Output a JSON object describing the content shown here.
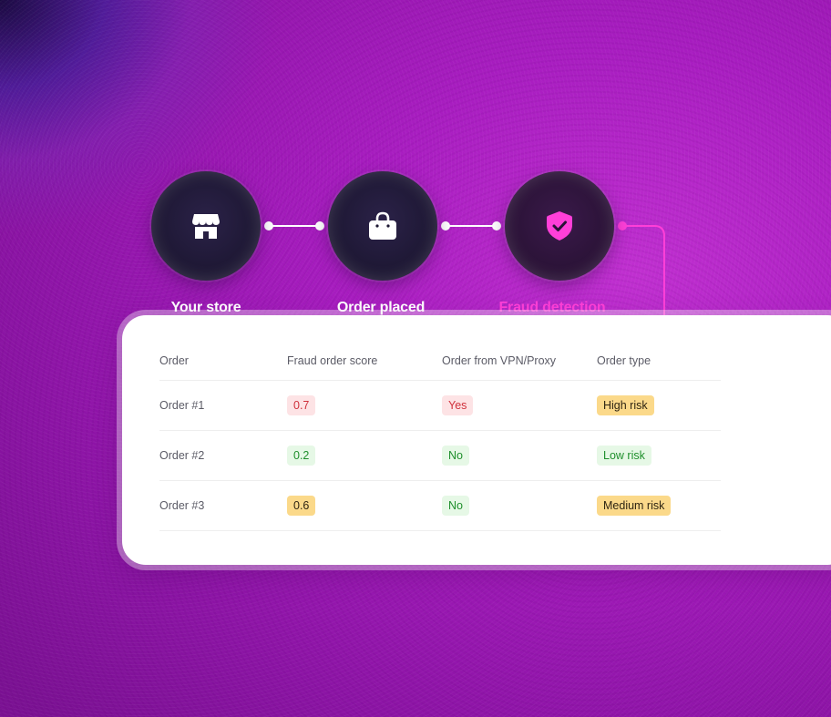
{
  "steps": [
    {
      "label": "Your store",
      "icon": "store-icon"
    },
    {
      "label": "Order placed",
      "icon": "shopping-bag-icon"
    },
    {
      "label": "Fraud detection",
      "icon": "shield-check-icon"
    }
  ],
  "table": {
    "headers": [
      "Order",
      "Fraud order score",
      "Order from VPN/Proxy",
      "Order type"
    ],
    "rows": [
      {
        "order": "Order #1",
        "score": "0.7",
        "vpn": "Yes",
        "type": "High risk"
      },
      {
        "order": "Order #2",
        "score": "0.2",
        "vpn": "No",
        "type": "Low risk"
      },
      {
        "order": "Order #3",
        "score": "0.6",
        "vpn": "No",
        "type": "Medium risk"
      }
    ]
  },
  "colors": {
    "accent": "#ff3fd8",
    "risk_high": "#fde3e5",
    "risk_low": "#e6f8e6",
    "risk_medium": "#fbd98a"
  }
}
